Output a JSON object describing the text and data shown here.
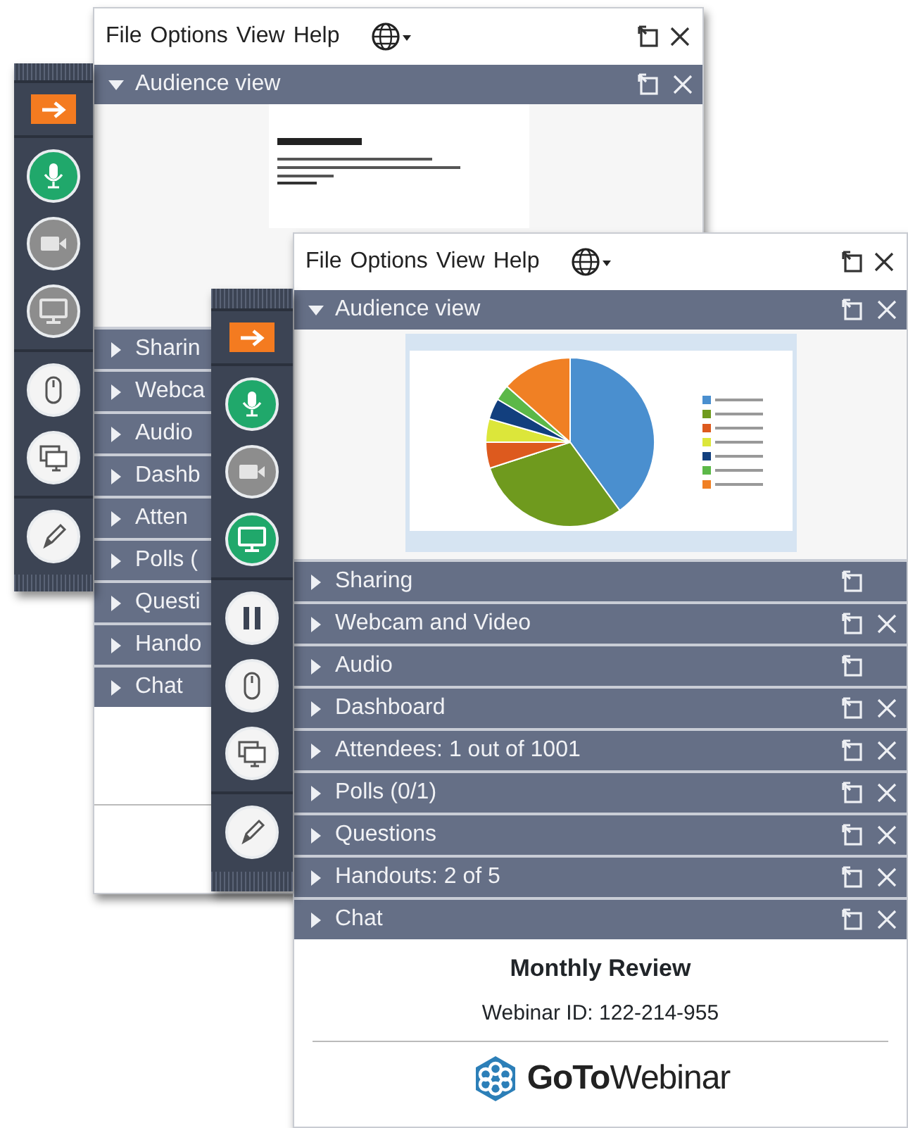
{
  "windows": [
    {
      "menu": [
        "File",
        "Options",
        "View",
        "Help"
      ],
      "tool_groups": [
        [
          {
            "kind": "present"
          }
        ],
        [
          {
            "kind": "microphone",
            "on": true
          },
          {
            "kind": "webcam",
            "on": false
          },
          {
            "kind": "screen",
            "on": false
          }
        ],
        [
          {
            "kind": "mouse"
          },
          {
            "kind": "screens"
          }
        ],
        [
          {
            "kind": "pen"
          }
        ]
      ],
      "audience_view": {
        "title": "Audience view",
        "expanded": true
      },
      "sections": [
        {
          "title": "Sharin",
          "expanded": false
        },
        {
          "title": "Webca",
          "expanded": false
        },
        {
          "title": "Audio",
          "expanded": false
        },
        {
          "title": "Dashb",
          "expanded": false
        },
        {
          "title": "Atten",
          "expanded": false
        },
        {
          "title": "Polls (",
          "expanded": false
        },
        {
          "title": "Questi",
          "expanded": false
        },
        {
          "title": "Hando",
          "expanded": false
        },
        {
          "title": "Chat",
          "expanded": false
        }
      ]
    },
    {
      "menu": [
        "File",
        "Options",
        "View",
        "Help"
      ],
      "tool_groups": [
        [
          {
            "kind": "present"
          }
        ],
        [
          {
            "kind": "microphone",
            "on": true
          },
          {
            "kind": "webcam",
            "on": false
          },
          {
            "kind": "screen",
            "on": true
          }
        ],
        [
          {
            "kind": "pause"
          },
          {
            "kind": "mouse"
          },
          {
            "kind": "screens"
          }
        ],
        [
          {
            "kind": "pen"
          }
        ]
      ],
      "audience_view": {
        "title": "Audience view",
        "expanded": true
      },
      "sections": [
        {
          "title": "Sharing",
          "expanded": false,
          "popout": true,
          "closable": false
        },
        {
          "title": "Webcam and Video",
          "expanded": false,
          "popout": true,
          "closable": true
        },
        {
          "title": "Audio",
          "expanded": false,
          "popout": true,
          "closable": false
        },
        {
          "title": "Dashboard",
          "expanded": false,
          "popout": true,
          "closable": true
        },
        {
          "title": "Attendees: 1 out of 1001",
          "expanded": false,
          "popout": true,
          "closable": true
        },
        {
          "title": "Polls (0/1)",
          "expanded": false,
          "popout": true,
          "closable": true
        },
        {
          "title": "Questions",
          "expanded": false,
          "popout": true,
          "closable": true
        },
        {
          "title": "Handouts: 2 of 5",
          "expanded": false,
          "popout": true,
          "closable": true
        },
        {
          "title": "Chat",
          "expanded": false,
          "popout": true,
          "closable": true
        }
      ],
      "footer": {
        "title": "Monthly Review",
        "webinar_id": "Webinar ID: 122-214-955",
        "brand": "**GoTo**Webinar"
      }
    }
  ]
}
